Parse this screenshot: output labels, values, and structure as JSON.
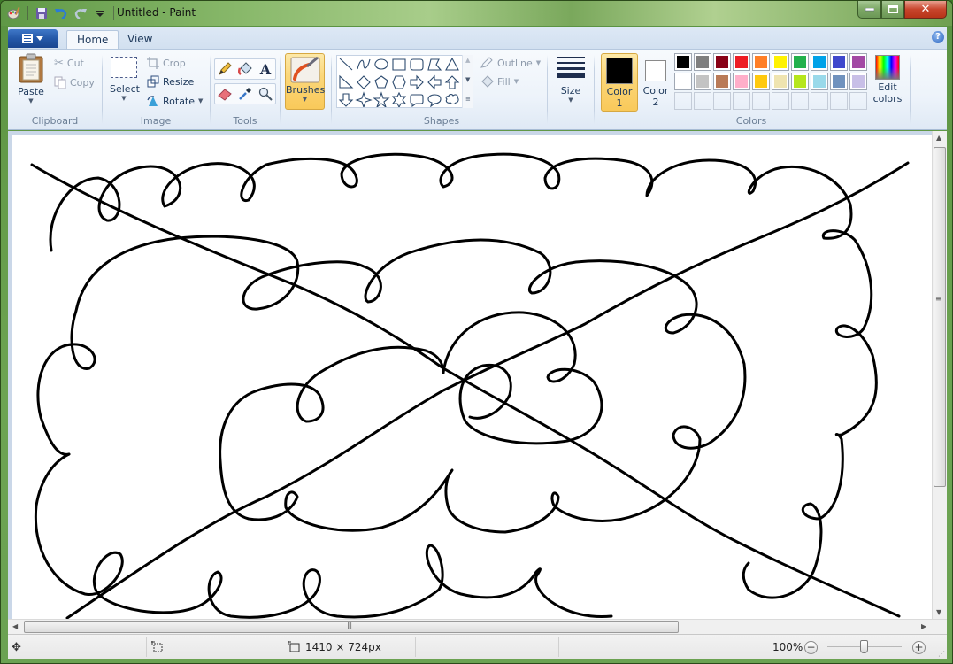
{
  "window": {
    "title": "Untitled - Paint",
    "controls": {
      "minimize": "minimize",
      "maximize": "maximize",
      "close": "close"
    }
  },
  "quick_access": [
    {
      "name": "paint-app-icon"
    },
    {
      "name": "save-icon"
    },
    {
      "name": "undo-icon"
    },
    {
      "name": "redo-icon"
    },
    {
      "name": "customize-qat-icon"
    }
  ],
  "tabs": [
    {
      "label": "Home",
      "active": true
    },
    {
      "label": "View",
      "active": false
    }
  ],
  "ribbon": {
    "clipboard": {
      "label": "Clipboard",
      "paste": "Paste",
      "cut": "Cut",
      "copy": "Copy"
    },
    "image": {
      "label": "Image",
      "select": "Select",
      "crop": "Crop",
      "resize": "Resize",
      "rotate": "Rotate"
    },
    "tools": {
      "label": "Tools",
      "items": [
        "pencil",
        "fill",
        "text",
        "eraser",
        "color-picker",
        "magnifier"
      ]
    },
    "brushes": {
      "label": "Brushes",
      "active": true
    },
    "shapes": {
      "label": "Shapes",
      "outline": "Outline",
      "fill": "Fill",
      "items": [
        "line",
        "curve",
        "oval",
        "rectangle",
        "rounded-rectangle",
        "polygon",
        "triangle",
        "right-triangle",
        "diamond",
        "pentagon",
        "hexagon",
        "right-arrow",
        "left-arrow",
        "up-arrow",
        "down-arrow",
        "four-point-star",
        "five-point-star",
        "six-point-star",
        "rounded-callout",
        "oval-callout",
        "cloud-callout"
      ]
    },
    "size": {
      "label": "Size"
    },
    "colors": {
      "label": "Colors",
      "color1": {
        "label_line1": "Color",
        "label_line2": "1",
        "value": "#000000"
      },
      "color2": {
        "label_line1": "Color",
        "label_line2": "2",
        "value": "#ffffff"
      },
      "palette_row1": [
        "#000000",
        "#7f7f7f",
        "#880015",
        "#ed1c24",
        "#ff7f27",
        "#fff200",
        "#22b14c",
        "#00a2e8",
        "#3f48cc",
        "#a349a4"
      ],
      "palette_row2": [
        "#ffffff",
        "#c3c3c3",
        "#b97a57",
        "#ffaec9",
        "#ffc90e",
        "#efe4b0",
        "#b5e61d",
        "#99d9ea",
        "#7092be",
        "#c8bfe7"
      ],
      "palette_row3_count": 10,
      "edit_colors_line1": "Edit",
      "edit_colors_line2": "colors"
    }
  },
  "canvas": {
    "background": "#ffffff",
    "stroke_color": "#000000"
  },
  "statusbar": {
    "image_size": "1410 × 724px",
    "zoom_level": "100%",
    "zoom_slider_fraction": 0.5
  }
}
